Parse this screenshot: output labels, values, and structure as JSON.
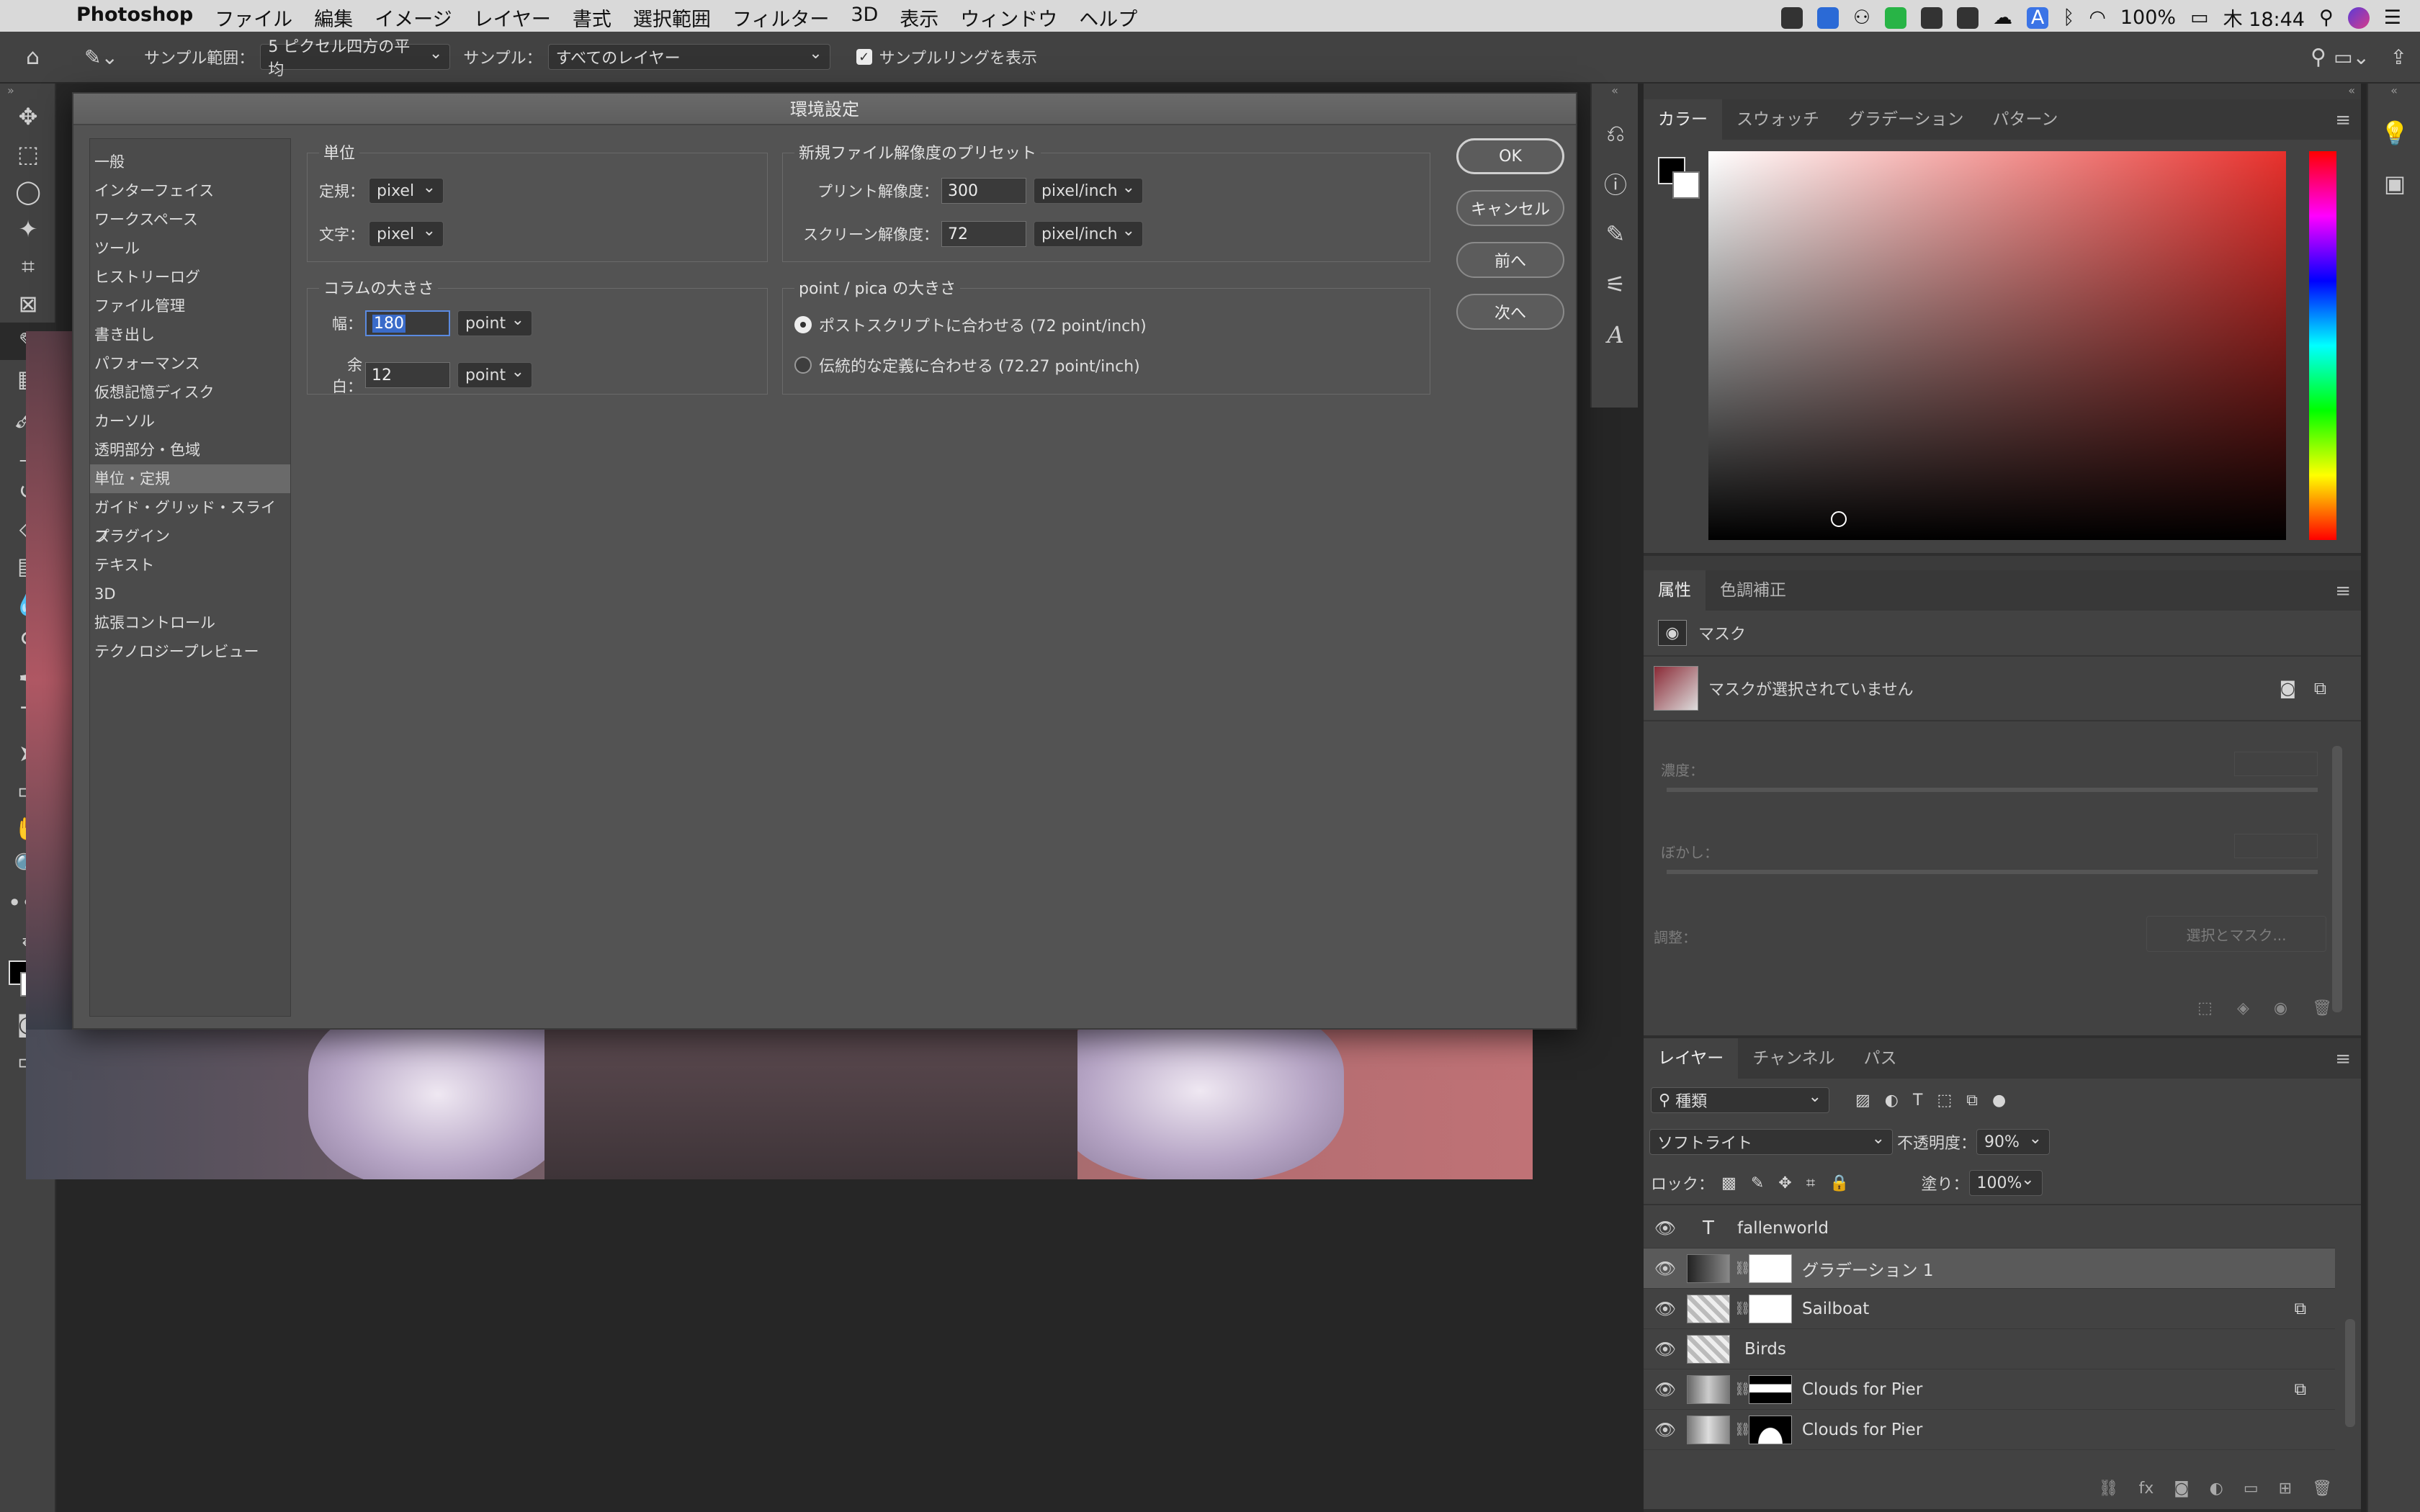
{
  "menubar": {
    "app": "Photoshop",
    "items": [
      "ファイル",
      "編集",
      "イメージ",
      "レイヤー",
      "書式",
      "選択範囲",
      "フィルター",
      "3D",
      "表示",
      "ウィンドウ",
      "ヘルプ"
    ],
    "battery": "100%",
    "clock": "木 18:44"
  },
  "options": {
    "sample_size_label": "サンプル範囲：",
    "sample_size_value": "5 ピクセル四方の平均",
    "sample_label": "サンプル：",
    "sample_value": "すべてのレイヤー",
    "show_ring_label": "サンプルリングを表示"
  },
  "dialog": {
    "title": "環境設定",
    "categories": [
      "一般",
      "インターフェイス",
      "ワークスペース",
      "ツール",
      "ヒストリーログ",
      "ファイル管理",
      "書き出し",
      "パフォーマンス",
      "仮想記憶ディスク",
      "カーソル",
      "透明部分・色域",
      "単位・定規",
      "ガイド・グリッド・スライス",
      "プラグイン",
      "テキスト",
      "3D",
      "拡張コントロール",
      "テクノロジープレビュー"
    ],
    "selected_category": "単位・定規",
    "units": {
      "title": "単位",
      "ruler_label": "定規：",
      "ruler_value": "pixel",
      "type_label": "文字：",
      "type_value": "pixel"
    },
    "resolution": {
      "title": "新規ファイル解像度のプリセット",
      "print_label": "プリント解像度：",
      "print_value": "300",
      "print_unit": "pixel/inch",
      "screen_label": "スクリーン解像度：",
      "screen_value": "72",
      "screen_unit": "pixel/inch"
    },
    "column": {
      "title": "コラムの大きさ",
      "width_label": "幅：",
      "width_value": "180",
      "width_unit": "point",
      "gutter_label": "余白：",
      "gutter_value": "12",
      "gutter_unit": "point"
    },
    "pica": {
      "title": "point / pica の大きさ",
      "option1": "ポストスクリプトに合わせる (72 point/inch)",
      "option2": "伝統的な定義に合わせる (72.27 point/inch)"
    },
    "buttons": {
      "ok": "OK",
      "cancel": "キャンセル",
      "prev": "前へ",
      "next": "次へ"
    }
  },
  "color_panel": {
    "tabs": [
      "カラー",
      "スウォッチ",
      "グラデーション",
      "パターン"
    ]
  },
  "properties_panel": {
    "tabs": [
      "属性",
      "色調補正"
    ],
    "section": "マスク",
    "no_mask": "マスクが選択されていません",
    "density_label": "濃度：",
    "feather_label": "ぼかし：",
    "adjust_label": "調整：",
    "select_mask_button": "選択とマスク..."
  },
  "layers_panel": {
    "tabs": [
      "レイヤー",
      "チャンネル",
      "パス"
    ],
    "filter_value": "種類",
    "blend_mode": "ソフトライト",
    "opacity_label": "不透明度：",
    "opacity_value": "90%",
    "lock_label": "ロック：",
    "fill_label": "塗り：",
    "fill_value": "100%",
    "layers": [
      {
        "name": "fallenworld"
      },
      {
        "name": "グラデーション 1"
      },
      {
        "name": "Sailboat"
      },
      {
        "name": "Birds"
      },
      {
        "name": "Clouds for Pier"
      },
      {
        "name": "Clouds for Pier"
      }
    ]
  }
}
